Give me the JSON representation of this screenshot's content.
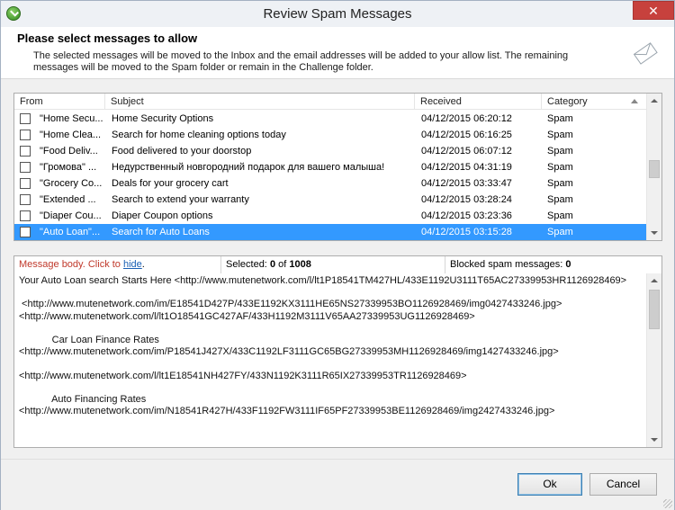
{
  "window": {
    "title": "Review Spam Messages",
    "close_glyph": "✕"
  },
  "header": {
    "heading": "Please select messages to allow",
    "description": "The selected messages will be moved to the Inbox and the email addresses will be added to your allow list. The remaining messages will be moved to the Spam folder or remain in the Challenge folder."
  },
  "list": {
    "columns": [
      "From",
      "Subject",
      "Received",
      "Category"
    ],
    "rows": [
      {
        "from": "\"Home Secu...",
        "subject": "Home Security Options",
        "received": "04/12/2015 06:20:12",
        "category": "Spam"
      },
      {
        "from": "\"Home Clea...",
        "subject": "Search for home cleaning options today",
        "received": "04/12/2015 06:16:25",
        "category": "Spam"
      },
      {
        "from": "\"Food Deliv...",
        "subject": "Food delivered to your doorstop",
        "received": "04/12/2015 06:07:12",
        "category": "Spam"
      },
      {
        "from": "\"Громова\" ...",
        "subject": "Недурственный новгородний подарок для вашего малыша!",
        "received": "04/12/2015 04:31:19",
        "category": "Spam"
      },
      {
        "from": "\"Grocery Co...",
        "subject": "Deals for your grocery cart",
        "received": "04/12/2015 03:33:47",
        "category": "Spam"
      },
      {
        "from": "\"Extended ...",
        "subject": "Search to extend your warranty",
        "received": "04/12/2015 03:28:24",
        "category": "Spam"
      },
      {
        "from": "\"Diaper Cou...",
        "subject": "Diaper Coupon options",
        "received": "04/12/2015 03:23:36",
        "category": "Spam"
      },
      {
        "from": "\"Auto Loan\"...",
        "subject": "Search for Auto Loans",
        "received": "04/12/2015 03:15:28",
        "category": "Spam"
      }
    ],
    "selected_index": 7
  },
  "status": {
    "body_label": "Message body.",
    "click_to": "Click to",
    "hide_link": "hide",
    "hide_period": ".",
    "selected_label": "Selected:",
    "selected_count": "0",
    "of_label": "of",
    "total_count": "1008",
    "blocked_label": "Blocked spam messages:",
    "blocked_count": "0"
  },
  "body_lines": [
    "Your Auto Loan search Starts Here <http://www.mutenetwork.com/l/lt1P18541TM427HL/433E1192U3111T65AC27339953HR1126928469>",
    "",
    " <http://www.mutenetwork.com/im/E18541D427P/433E1192KX3111HE65NS27339953BO1126928469/img0427433246.jpg>",
    "<http://www.mutenetwork.com/l/lt1O18541GC427AF/433H1192M3111V65AA27339953UG1126928469>",
    "",
    "            Car Loan Finance Rates",
    "<http://www.mutenetwork.com/im/P18541J427X/433C1192LF3111GC65BG27339953MH1126928469/img1427433246.jpg>",
    "",
    "<http://www.mutenetwork.com/l/lt1E18541NH427FY/433N1192K3111R65IX27339953TR1126928469>",
    "",
    "            Auto Financing Rates",
    "<http://www.mutenetwork.com/im/N18541R427H/433F1192FW3111IF65PF27339953BE1126928469/img2427433246.jpg>"
  ],
  "buttons": {
    "ok": "Ok",
    "cancel": "Cancel"
  }
}
